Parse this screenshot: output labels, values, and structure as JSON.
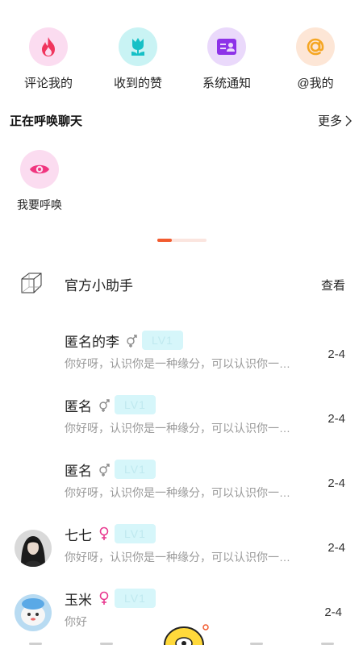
{
  "quick_entries": [
    {
      "label": "评论我的",
      "icon": "flame-icon",
      "bg": "#fbdcf0",
      "color": "#f0355d"
    },
    {
      "label": "收到的赞",
      "icon": "tulip-icon",
      "bg": "#c9f3f4",
      "color": "#16c0c6"
    },
    {
      "label": "系统通知",
      "icon": "id-card-icon",
      "bg": "#ead9fb",
      "color": "#8d32e8"
    },
    {
      "label": "@我的",
      "icon": "at-icon",
      "bg": "#fde6d6",
      "color": "#f5a623"
    }
  ],
  "calling": {
    "title": "正在呼唤聊天",
    "more_label": "更多",
    "entry_label": "我要呼唤",
    "entry_icon": "eye-icon",
    "accent": "#f0357f"
  },
  "assistant": {
    "name": "官方小助手",
    "action": "查看",
    "icon": "cube-icon"
  },
  "conversations": [
    {
      "name": "匿名的李",
      "gender": "unknown",
      "level": "LV1",
      "message": "你好呀，认识你是一种缘分，可以认识你一下吗",
      "date": "2-4",
      "avatar": "none"
    },
    {
      "name": "匿名",
      "gender": "unknown",
      "level": "LV1",
      "message": "你好呀，认识你是一种缘分，可以认识你一下吗",
      "date": "2-4",
      "avatar": "none"
    },
    {
      "name": "匿名",
      "gender": "unknown",
      "level": "LV1",
      "message": "你好呀，认识你是一种缘分，可以认识你一下吗",
      "date": "2-4",
      "avatar": "none"
    },
    {
      "name": "七七",
      "gender": "female",
      "level": "LV1",
      "message": "你好呀，认识你是一种缘分，可以认识你一下吗",
      "date": "2-4",
      "avatar": "photo-dark"
    },
    {
      "name": "玉米",
      "gender": "female",
      "level": "LV1",
      "message": "你好",
      "date": "2-4",
      "avatar": "photo-cartoon"
    }
  ],
  "colors": {
    "accent_orange": "#f25b2f",
    "level_bg": "#d6f6fa",
    "female": "#e8388f",
    "gender_unknown": "#8c8c8c"
  }
}
